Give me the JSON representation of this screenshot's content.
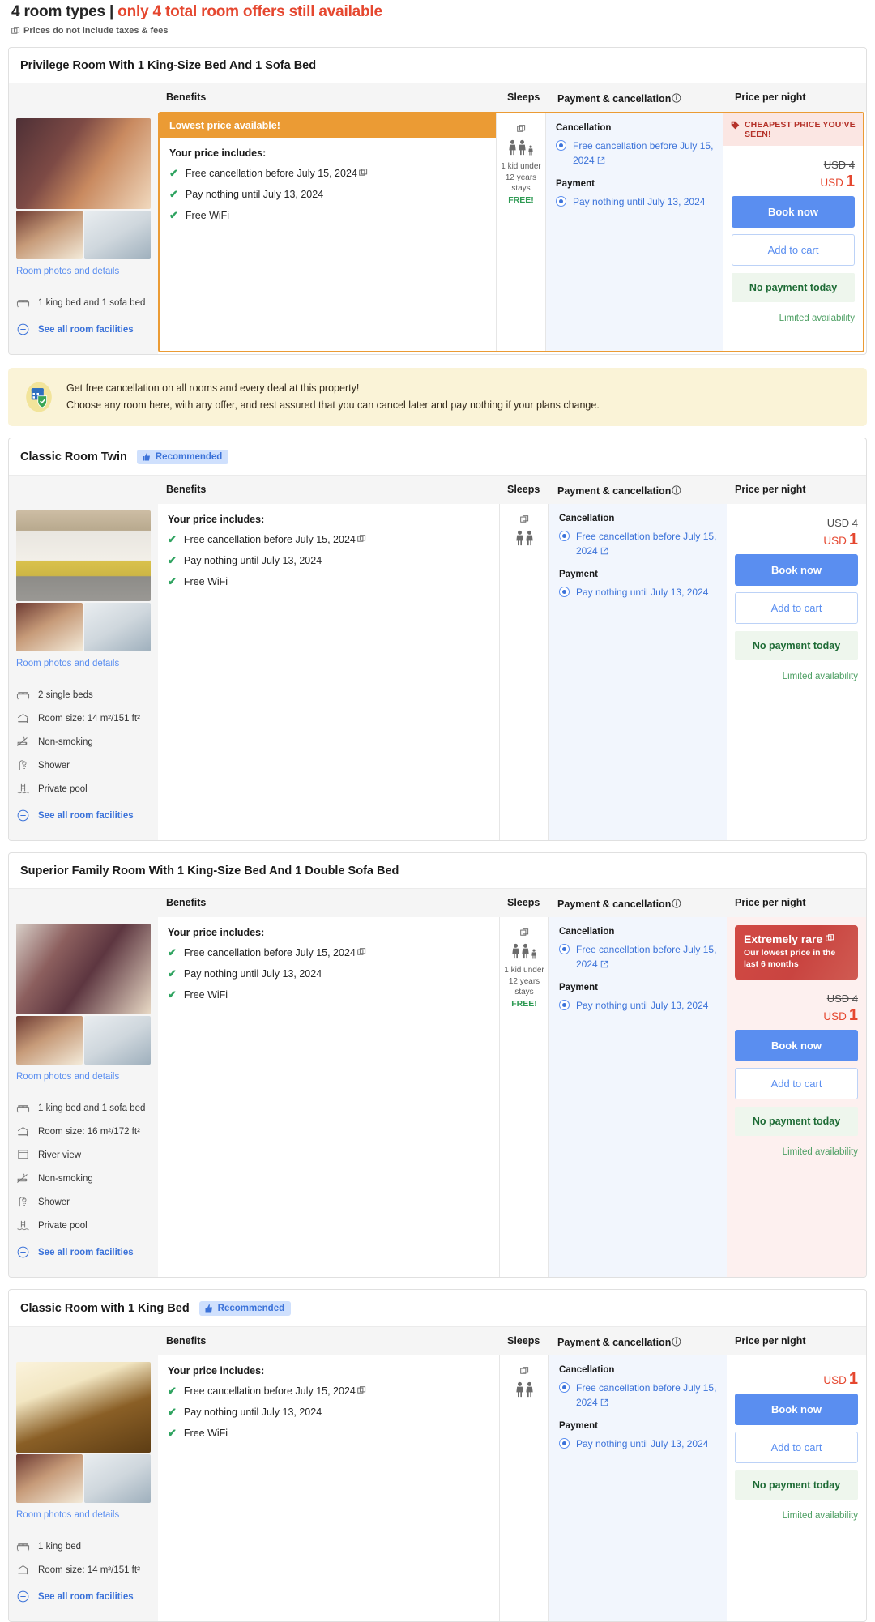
{
  "header": {
    "room_types_count": "4 room types",
    "separator": "|",
    "availability_alert": "only 4 total room offers still available",
    "tax_note": "Prices do not include taxes & fees",
    "tax_icon": "external-window-icon"
  },
  "columns": {
    "benefits": "Benefits",
    "sleeps": "Sleeps",
    "payment": "Payment & cancellation",
    "payment_info_icon": "ⓘ",
    "price": "Price per night"
  },
  "common": {
    "your_price_includes": "Your price includes:",
    "benefit_free_cancellation": "Free cancellation before July 15, 2024",
    "benefit_pay_nothing": "Pay nothing until July 13, 2024",
    "benefit_free_wifi": "Free WiFi",
    "cancellation_label": "Cancellation",
    "cancellation_option": "Free cancellation before July 15, 2024",
    "payment_label": "Payment",
    "payment_option": "Pay nothing until July 13, 2024",
    "book_now": "Book now",
    "add_to_cart": "Add to cart",
    "no_payment_today": "No payment today",
    "limited_availability": "Limited availability",
    "room_photos_link": "Room photos and details",
    "see_all_facilities": "See all room facilities",
    "currency": "USD",
    "recommended_badge": "Recommended"
  },
  "free_cancellation_banner": {
    "icon": "calendar-shield-icon",
    "line1": "Get free cancellation on all rooms and every deal at this property!",
    "line2": "Choose any room here, with any offer, and rest assured that you can cancel later and pay nothing if your plans change."
  },
  "rooms": [
    {
      "id": "privilege-king-sofa",
      "title": "Privilege Room With 1 King-Size Bed And 1 Sofa Bed",
      "recommended": false,
      "photo_style": "privilege",
      "facilities": [
        {
          "icon": "bed-icon",
          "label": "1 king bed and 1 sofa bed"
        }
      ],
      "offer": {
        "lowest_price_banner": "Lowest price available!",
        "highlighted": true,
        "sleeps": {
          "adults": 2,
          "kids": 1,
          "note_line1": "1 kid under",
          "note_line2": "12 years",
          "note_line3": "stays",
          "free_label": "FREE!"
        },
        "price_badge": {
          "type": "cheapest",
          "icon": "price-tag-icon",
          "text": "CHEAPEST PRICE YOU’VE SEEN!"
        },
        "old_price": "USD 4",
        "currency": "USD",
        "price": "1"
      }
    },
    {
      "id": "classic-twin",
      "title": "Classic Room Twin",
      "recommended": true,
      "photo_style": "twin",
      "facilities": [
        {
          "icon": "bed-icon",
          "label": "2 single beds"
        },
        {
          "icon": "room-size-icon",
          "label": "Room size: 14 m²/151 ft²"
        },
        {
          "icon": "non-smoking-icon",
          "label": "Non-smoking"
        },
        {
          "icon": "shower-icon",
          "label": "Shower"
        },
        {
          "icon": "pool-icon",
          "label": "Private pool"
        }
      ],
      "offer": {
        "lowest_price_banner": null,
        "highlighted": false,
        "sleeps": {
          "adults": 2,
          "kids": 0
        },
        "price_badge": null,
        "old_price": "USD 4",
        "currency": "USD",
        "price": "1"
      }
    },
    {
      "id": "superior-family",
      "title": "Superior Family Room With 1 King-Size Bed And 1 Double Sofa Bed",
      "recommended": false,
      "photo_style": "family",
      "facilities": [
        {
          "icon": "bed-icon",
          "label": "1 king bed and 1 sofa bed"
        },
        {
          "icon": "room-size-icon",
          "label": "Room size: 16 m²/172 ft²"
        },
        {
          "icon": "window-view-icon",
          "label": "River view"
        },
        {
          "icon": "non-smoking-icon",
          "label": "Non-smoking"
        },
        {
          "icon": "shower-icon",
          "label": "Shower"
        },
        {
          "icon": "pool-icon",
          "label": "Private pool"
        }
      ],
      "offer": {
        "lowest_price_banner": null,
        "highlighted": false,
        "sleeps": {
          "adults": 2,
          "kids": 1,
          "note_line1": "1 kid under",
          "note_line2": "12 years",
          "note_line3": "stays",
          "free_label": "FREE!"
        },
        "price_badge": {
          "type": "rare",
          "title": "Extremely rare",
          "icon": "external-window-icon",
          "subtitle": "Our lowest price in the last 6 months"
        },
        "old_price": "USD 4",
        "currency": "USD",
        "price": "1"
      }
    },
    {
      "id": "classic-king",
      "title": "Classic Room with 1 King Bed",
      "recommended": true,
      "photo_style": "king",
      "facilities": [
        {
          "icon": "bed-icon",
          "label": "1 king bed"
        },
        {
          "icon": "room-size-icon",
          "label": "Room size: 14 m²/151 ft²"
        }
      ],
      "offer": {
        "lowest_price_banner": null,
        "highlighted": false,
        "sleeps": {
          "adults": 2,
          "kids": 0
        },
        "price_badge": null,
        "old_price": null,
        "currency": "USD",
        "price": "1"
      }
    }
  ],
  "colors": {
    "alert_red": "#e5472f",
    "accent_blue": "#5a8ef0",
    "orange": "#eb9b34",
    "green": "#2fa360",
    "rare_red": "#c94440"
  }
}
